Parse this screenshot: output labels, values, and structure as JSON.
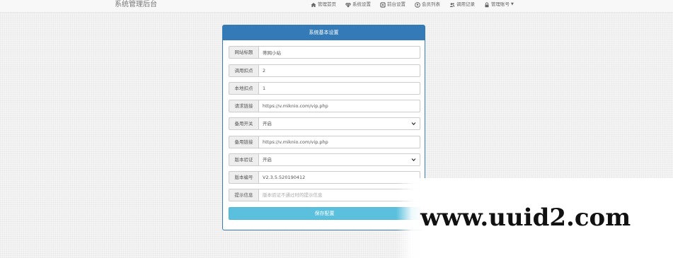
{
  "topbar": {
    "brand": "系统管理后台",
    "nav": [
      {
        "icon": "home-icon",
        "label": "管理首页"
      },
      {
        "icon": "diamond-icon",
        "label": "系统设置"
      },
      {
        "icon": "grid-icon",
        "label": "前台设置"
      },
      {
        "icon": "user-circle-icon",
        "label": "会员列表"
      },
      {
        "icon": "users-icon",
        "label": "调用记录"
      },
      {
        "icon": "lock-icon",
        "label": "管理账号",
        "dropdown": true
      }
    ]
  },
  "panel": {
    "title": "系统基本设置",
    "fields": [
      {
        "label": "网站标题",
        "value": "蒂网小站"
      },
      {
        "label": "调用扣点",
        "value": "2"
      },
      {
        "label": "本地扣点",
        "value": "1"
      },
      {
        "label": "请求链接",
        "value": "https://v.miknio.com/vip.php"
      },
      {
        "label": "备用开关",
        "value": "开启",
        "type": "select"
      },
      {
        "label": "备用链接",
        "value": "https://v.miknio.com/vip.php"
      },
      {
        "label": "版本验证",
        "value": "开启",
        "type": "select"
      },
      {
        "label": "版本编号",
        "value": "V2.3.5.520190412"
      },
      {
        "label": "提示信息",
        "value": "",
        "placeholder": "版本验证不通过时的提示信息"
      }
    ],
    "save_label": "保存配置"
  },
  "watermark": {
    "text": "www.uuid2.com"
  }
}
